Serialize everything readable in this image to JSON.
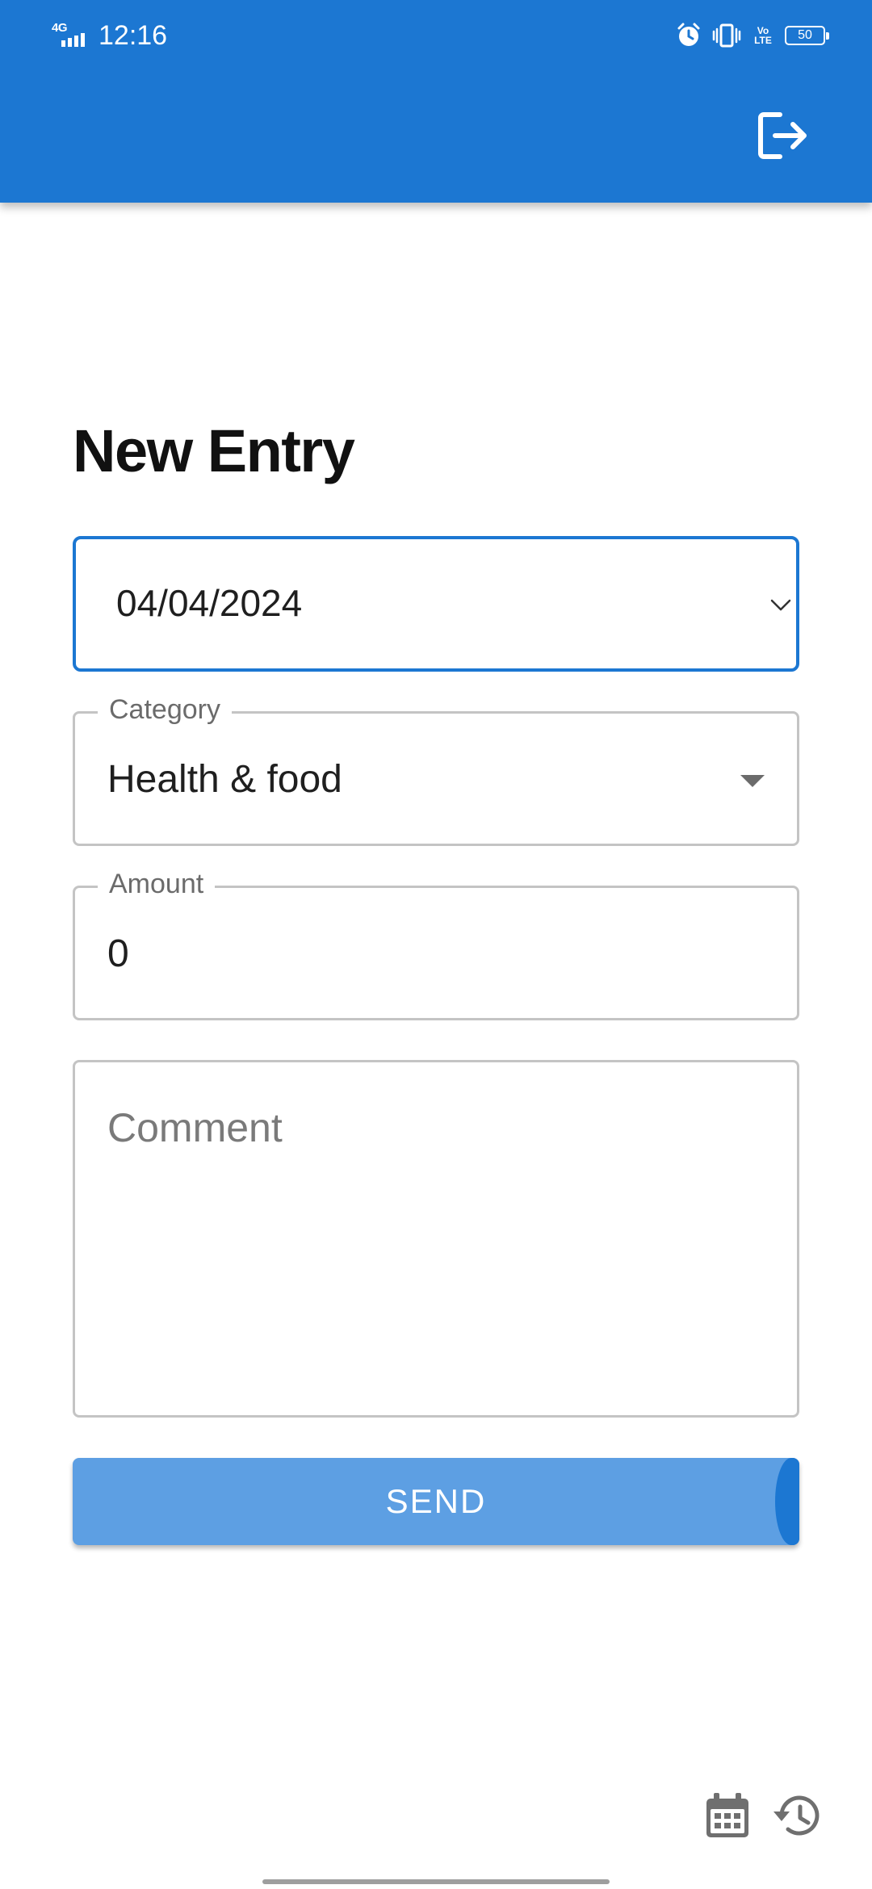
{
  "status_bar": {
    "network": "4G",
    "time": "12:16",
    "volte": "Vo LTE",
    "battery": "50"
  },
  "icons": {
    "logout": "logout-icon",
    "calendar": "calendar-icon",
    "history": "history-icon",
    "alarm": "alarm-icon",
    "vibrate": "vibrate-icon",
    "signal": "signal-icon",
    "battery": "battery-icon"
  },
  "form": {
    "title": "New Entry",
    "date": {
      "value": "04/04/2024"
    },
    "category": {
      "label": "Category",
      "value": "Health & food"
    },
    "amount": {
      "label": "Amount",
      "value": "0"
    },
    "comment": {
      "placeholder": "Comment"
    },
    "send_label": "SEND"
  },
  "colors": {
    "primary": "#1c77d2",
    "button_disabled": "#5d9fe3",
    "outline": "#c4c4c4",
    "label": "#6b6b6b"
  }
}
